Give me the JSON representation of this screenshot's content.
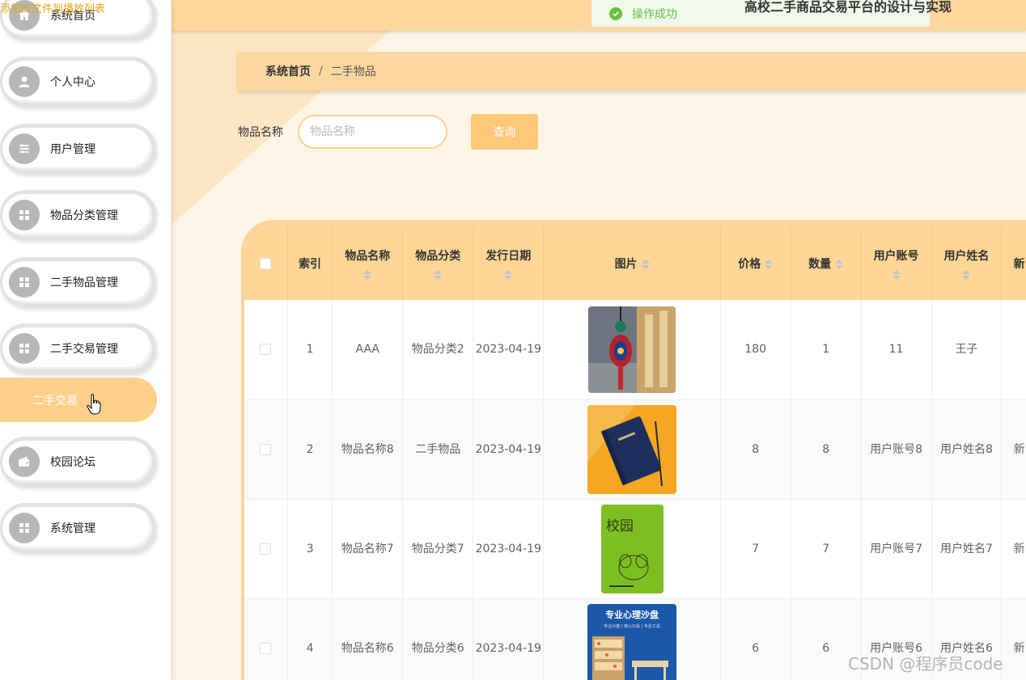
{
  "overlay_text": "添加的文件到播放列表",
  "header": {
    "toast": "操作成功",
    "site_title": "高校二手商品交易平台的设计与实现"
  },
  "sidebar": {
    "items": [
      {
        "label": "系统首页",
        "icon": "home-icon"
      },
      {
        "label": "个人中心",
        "icon": "user-icon"
      },
      {
        "label": "用户管理",
        "icon": "sliders-icon"
      },
      {
        "label": "物品分类管理",
        "icon": "grid-icon"
      },
      {
        "label": "二手物品管理",
        "icon": "grid-icon"
      },
      {
        "label": "二手交易管理",
        "icon": "grid-icon"
      },
      {
        "label": "校园论坛",
        "icon": "wallet-icon"
      },
      {
        "label": "系统管理",
        "icon": "grid-icon"
      }
    ],
    "active_submenu": "二手交易"
  },
  "breadcrumb": {
    "home": "系统首页",
    "separator": "/",
    "current": "二手物品"
  },
  "search": {
    "label": "物品名称",
    "placeholder": "物品名称",
    "button": "查询"
  },
  "table": {
    "columns": [
      "索引",
      "物品名称",
      "物品分类",
      "发行日期",
      "图片",
      "价格",
      "数量",
      "用户账号",
      "用户姓名",
      "新"
    ],
    "rows": [
      {
        "index": "1",
        "name": "AAA",
        "category": "物品分类2",
        "date": "2023-04-19",
        "image": "tassel-photo",
        "price": "180",
        "qty": "1",
        "account": "11",
        "username": "王子",
        "extra": ""
      },
      {
        "index": "2",
        "name": "物品名称8",
        "category": "二手物品",
        "date": "2023-04-19",
        "image": "notebook-photo",
        "price": "8",
        "qty": "8",
        "account": "用户账号8",
        "username": "用户姓名8",
        "extra": "新"
      },
      {
        "index": "3",
        "name": "物品名称7",
        "category": "物品分类7",
        "date": "2023-04-19",
        "image": "green-book-photo",
        "price": "7",
        "qty": "7",
        "account": "用户账号7",
        "username": "用户姓名7",
        "extra": "新"
      },
      {
        "index": "4",
        "name": "物品名称6",
        "category": "物品分类6",
        "date": "2023-04-19",
        "image": "sandbox-photo",
        "price": "6",
        "qty": "6",
        "account": "用户账号6",
        "username": "用户姓名6",
        "extra": "新"
      }
    ],
    "image_texts": {
      "book_title": "校园",
      "sandbox_title": "专业心理沙盘",
      "sandbox_sub": "专业沙盘 | 核心沙具 | 专业工具"
    }
  },
  "watermark": "CSDN @程序员code",
  "colors": {
    "accent": "#ffd695",
    "button": "#fdc978",
    "submenu_active": "#fdd08a",
    "toast_green": "#67c23a"
  }
}
